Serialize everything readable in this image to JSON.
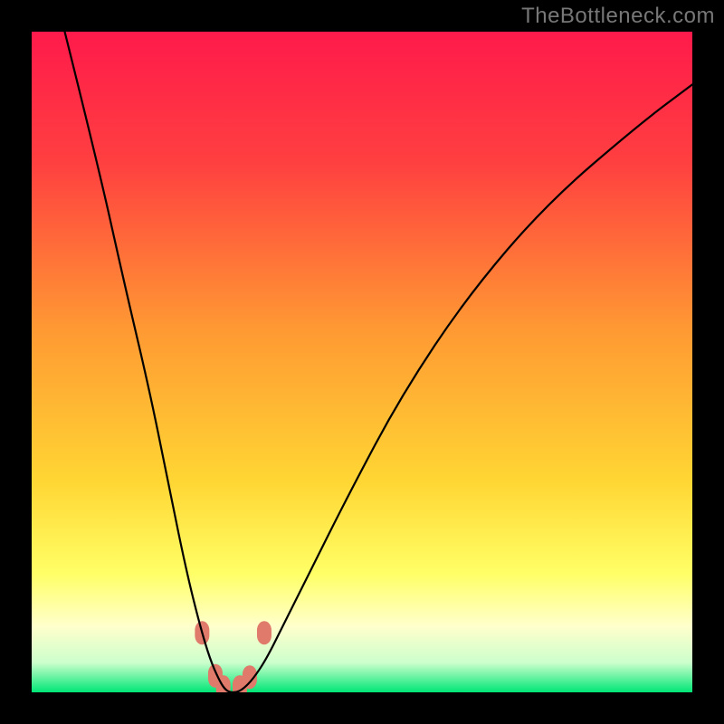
{
  "watermark": "TheBottleneck.com",
  "chart_data": {
    "type": "line",
    "title": "",
    "xlabel": "",
    "ylabel": "",
    "xlim": [
      0,
      100
    ],
    "ylim": [
      0,
      100
    ],
    "background_gradient": {
      "stops": [
        {
          "offset": 0.0,
          "color": "#ff1a4b"
        },
        {
          "offset": 0.2,
          "color": "#ff4040"
        },
        {
          "offset": 0.45,
          "color": "#ff9933"
        },
        {
          "offset": 0.68,
          "color": "#ffd633"
        },
        {
          "offset": 0.82,
          "color": "#ffff66"
        },
        {
          "offset": 0.9,
          "color": "#ffffcc"
        },
        {
          "offset": 0.955,
          "color": "#ccffcc"
        },
        {
          "offset": 1.0,
          "color": "#00e676"
        }
      ]
    },
    "series": [
      {
        "name": "bottleneck-curve",
        "stroke": "#000000",
        "stroke_width": 2.2,
        "x": [
          5,
          10,
          14,
          18,
          21,
          23.5,
          25.5,
          27,
          28.3,
          29.2,
          30,
          31,
          32,
          33.5,
          35.5,
          38,
          42,
          48,
          56,
          66,
          78,
          92,
          100
        ],
        "values": [
          100,
          80,
          62,
          45,
          30,
          18,
          10,
          5,
          2,
          0.5,
          0,
          0,
          0.5,
          2,
          5,
          10,
          18,
          30,
          45,
          60,
          74,
          86,
          92
        ]
      }
    ],
    "markers": [
      {
        "x": 25.8,
        "y": 9.0,
        "color": "#e07a6a"
      },
      {
        "x": 27.8,
        "y": 2.5,
        "color": "#e07a6a"
      },
      {
        "x": 29.0,
        "y": 0.8,
        "color": "#e07a6a"
      },
      {
        "x": 31.5,
        "y": 0.8,
        "color": "#e07a6a"
      },
      {
        "x": 33.0,
        "y": 2.3,
        "color": "#e07a6a"
      },
      {
        "x": 35.2,
        "y": 9.0,
        "color": "#e07a6a"
      }
    ]
  }
}
